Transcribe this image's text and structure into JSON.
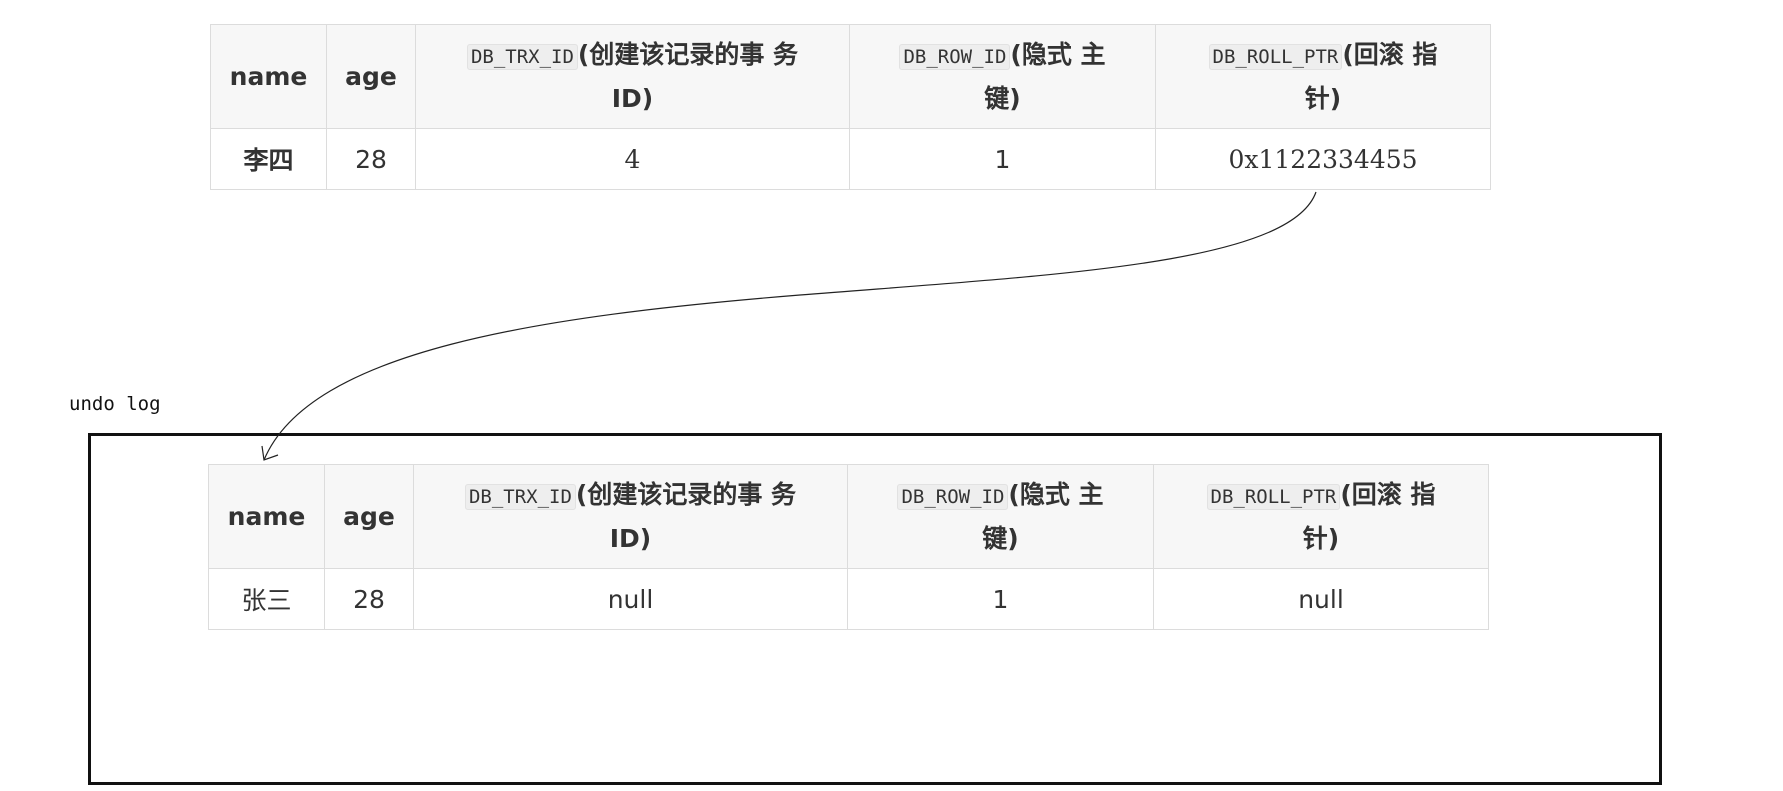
{
  "headers": {
    "name": "name",
    "age": "age",
    "trx_code": "DB_TRX_ID",
    "trx_desc_1": "(创建该记录的事 务",
    "trx_desc_2": "ID)",
    "row_code": "DB_ROW_ID",
    "row_desc_1": "(隐式 主",
    "row_desc_2": "键)",
    "roll_code": "DB_ROLL_PTR",
    "roll_desc_1": "(回滚 指",
    "roll_desc_2": "针)"
  },
  "current_record": {
    "name": "李四",
    "age": "28",
    "db_trx_id": "4",
    "db_row_id": "1",
    "db_roll_ptr": "0x1122334455"
  },
  "undo_log": {
    "label": "undo log",
    "record": {
      "name": "张三",
      "age": "28",
      "db_trx_id": "null",
      "db_row_id": "1",
      "db_roll_ptr": "null"
    }
  }
}
